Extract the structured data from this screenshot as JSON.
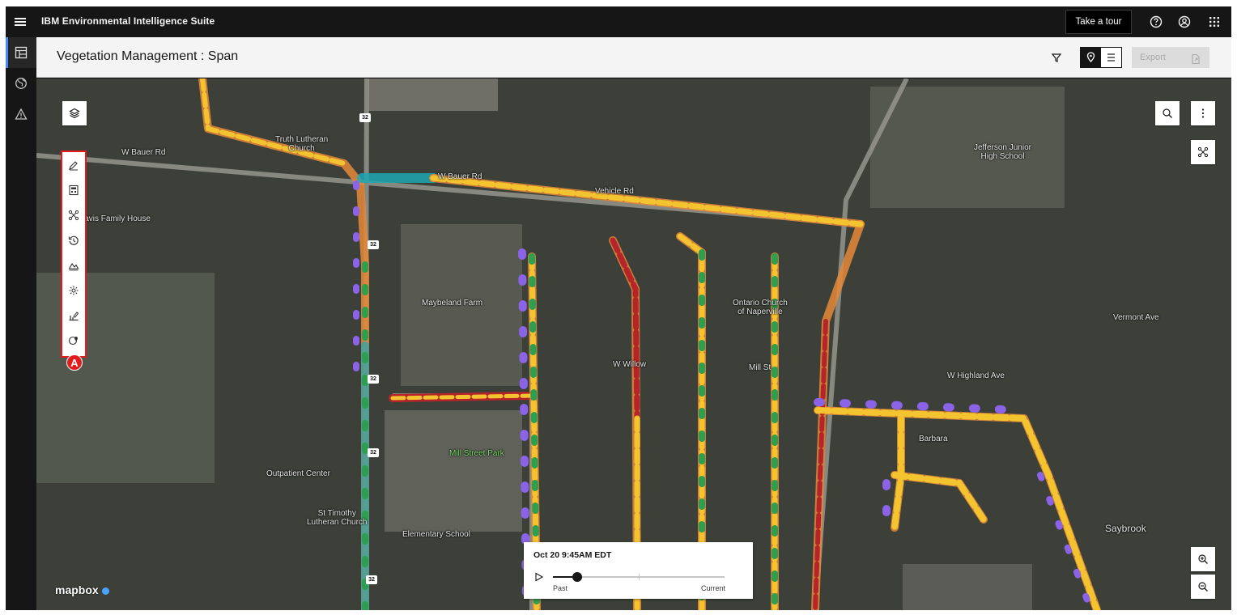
{
  "header": {
    "app_title": "IBM Environmental Intelligence Suite",
    "tour_label": "Take a tour",
    "icons": [
      "menu-icon",
      "help-icon",
      "user-icon",
      "app-switcher-icon"
    ]
  },
  "rail": {
    "items": [
      {
        "name": "dashboard-icon",
        "active": true
      },
      {
        "name": "globe-icon",
        "active": false
      },
      {
        "name": "warning-icon",
        "active": false
      }
    ]
  },
  "page": {
    "title": "Vegetation Management : Span",
    "export_label": "Export"
  },
  "toolbar": {
    "badge": "A",
    "tools": [
      "edit-icon",
      "calculator-icon",
      "network-icon",
      "history-icon",
      "layers-terrain-icon",
      "gear-icon",
      "chart-pencil-icon",
      "globe-pin-icon"
    ]
  },
  "map": {
    "attribution": "mapbox",
    "labels": {
      "truth_lutheran": "Truth Lutheran\nChurch",
      "davis_family": "Davis Family House",
      "wbauer_left": "W Bauer Rd",
      "wbauer_right": "W Bauer Rd",
      "vehicle": "Vehicle Rd",
      "jefferson": "Jefferson Junior\nHigh School",
      "maybeland": "Maybeland Farm",
      "ontario_church": "Ontario Church\nof Naperville",
      "willow": "W Willow",
      "mill_st": "Mill St",
      "outpatient": "Outpatient Center",
      "st_timothy": "St Timothy\nLutheran Church",
      "elementary": "Elementary School",
      "millstone_park": "Mill Street Park",
      "saybrook": "Saybrook",
      "barbara": "Barbara",
      "wiehle": "W Highland Ave",
      "vermont": "Vermont Ave"
    },
    "shields": [
      "32",
      "32",
      "32",
      "32",
      "32"
    ]
  },
  "time_slider": {
    "timestamp": "Oct 20 9:45AM EDT",
    "past_label": "Past",
    "current_label": "Current",
    "position": 0.14
  },
  "colors": {
    "risk_high": "#b52428",
    "risk_medium": "#f4c430",
    "risk_low": "#2e9e4f",
    "span_corridor": "#e58a3a",
    "span_selected": "#1fa7b3",
    "canopy_overhang": "#8a63e6",
    "annotation": "#e51b1b"
  }
}
